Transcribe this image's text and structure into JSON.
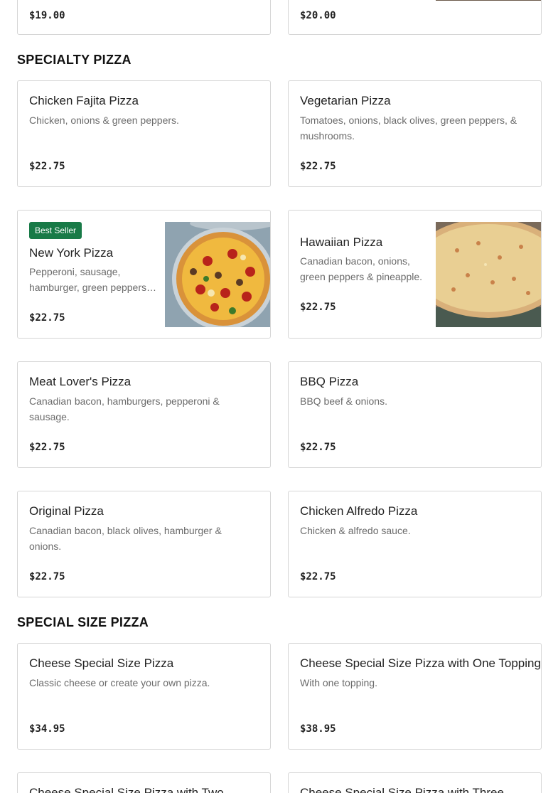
{
  "top_cards": [
    {
      "price": "$19.00"
    },
    {
      "price": "$20.00"
    }
  ],
  "sections": {
    "specialty": "SPECIALTY PIZZA",
    "special_size": "SPECIAL SIZE PIZZA"
  },
  "specialty_items": [
    {
      "name": "Chicken Fajita Pizza",
      "desc": "Chicken, onions & green peppers.",
      "price": "$22.75"
    },
    {
      "name": "Vegetarian Pizza",
      "desc": "Tomatoes, onions, black olives, green peppers, & mushrooms.",
      "price": "$22.75"
    },
    {
      "badge": "Best Seller",
      "name": "New York Pizza",
      "desc": "Pepperoni, sausage, hamburger, green peppers, onions & mushrooms.",
      "price": "$22.75"
    },
    {
      "name": "Hawaiian Pizza",
      "desc": "Canadian bacon, onions, green peppers & pineapple.",
      "price": "$22.75"
    },
    {
      "name": "Meat Lover's Pizza",
      "desc": "Canadian bacon, hamburgers, pepperoni & sausage.",
      "price": "$22.75"
    },
    {
      "name": "BBQ Pizza",
      "desc": "BBQ beef & onions.",
      "price": "$22.75"
    },
    {
      "name": "Original Pizza",
      "desc": "Canadian bacon, black olives, hamburger & onions.",
      "price": "$22.75"
    },
    {
      "name": "Chicken Alfredo Pizza",
      "desc": "Chicken & alfredo sauce.",
      "price": "$22.75"
    }
  ],
  "special_size_items": [
    {
      "name": "Cheese Special Size Pizza",
      "desc": "Classic cheese or create your own pizza.",
      "price": "$34.95"
    },
    {
      "name": "Cheese Special Size Pizza with One Topping",
      "desc": "With one topping.",
      "price": "$38.95"
    },
    {
      "name": "Cheese Special Size Pizza with Two"
    },
    {
      "name": "Cheese Special Size Pizza with Three"
    }
  ],
  "colors": {
    "badge_bg": "#187a47",
    "card_border": "#d6d6d6"
  }
}
